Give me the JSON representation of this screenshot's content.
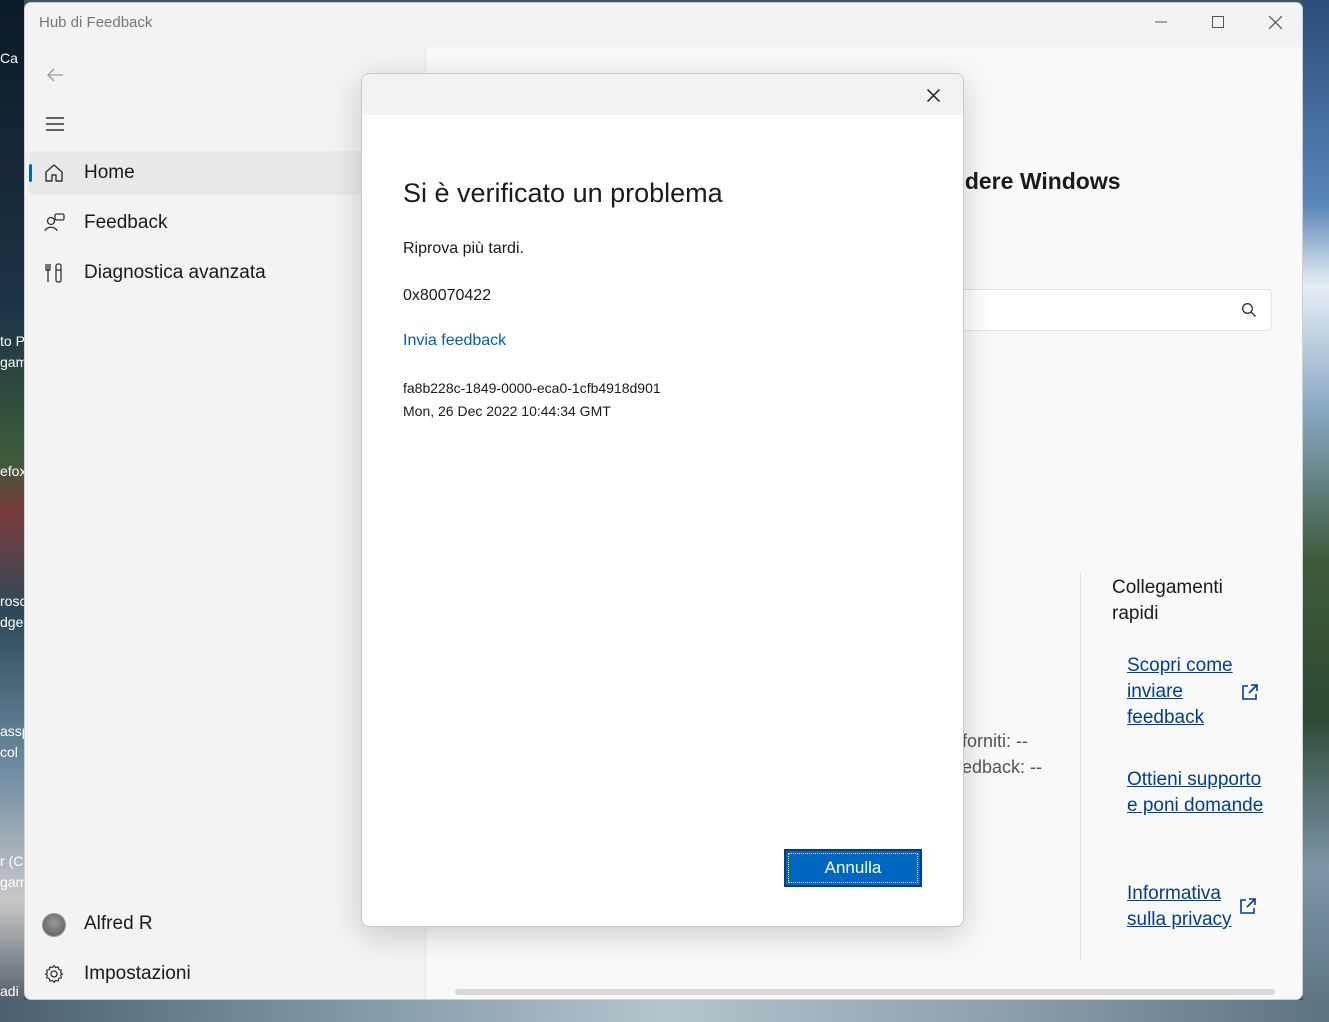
{
  "window": {
    "title": "Hub di Feedback"
  },
  "nav": {
    "items": [
      {
        "label": "Home",
        "icon": "home-icon",
        "selected": true
      },
      {
        "label": "Feedback",
        "icon": "feedback-icon",
        "selected": false
      },
      {
        "label": "Diagnostica avanzata",
        "icon": "diagnostics-icon",
        "selected": false
      }
    ],
    "account": {
      "label": "Alfred R"
    },
    "settings": {
      "label": "Impostazioni"
    }
  },
  "background": {
    "heading": "endere Windows",
    "search_stub": "s",
    "stats": [
      "forniti: --",
      "edback: --"
    ]
  },
  "quick_links": {
    "title": "Collegamenti rapidi",
    "links": [
      {
        "label": "Scopri come inviare feedback",
        "external": true
      },
      {
        "label": "Ottieni supporto e poni domande",
        "external": false
      },
      {
        "label": "Informativa sulla privacy",
        "external": true
      }
    ]
  },
  "desktop_labels": [
    "Ca",
    "to P",
    "gam",
    "efox",
    "rosc",
    "dge",
    "assp",
    "col",
    "r (C",
    "gam",
    "adi"
  ],
  "dialog": {
    "title": "Si è verificato un problema",
    "message": "Riprova più tardi.",
    "error_code": "0x80070422",
    "link": "Invia feedback",
    "correlation_id": "fa8b228c-1849-0000-eca0-1cfb4918d901",
    "timestamp": "Mon, 26 Dec 2022 10:44:34 GMT",
    "cancel_label": "Annulla"
  },
  "colors": {
    "accent": "#0067c0",
    "link": "#005fb8",
    "quick_link": "#003e92"
  }
}
